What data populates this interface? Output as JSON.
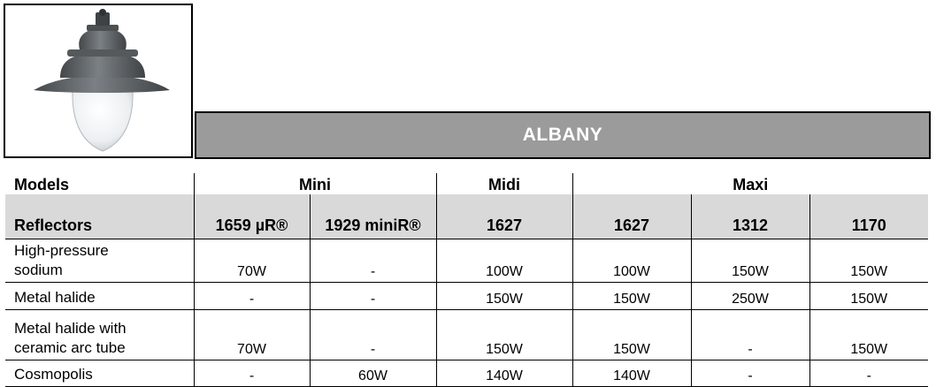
{
  "product": {
    "name": "ALBANY",
    "image": "street-lantern-luminaire"
  },
  "table": {
    "models_label": "Models",
    "groups": [
      "Mini",
      "Midi",
      "Maxi"
    ],
    "reflectors_label": "Reflectors",
    "reflectors": [
      "1659  µR®",
      "1929 miniR®",
      "1627",
      "1627",
      "1312",
      "1170"
    ],
    "rows": [
      {
        "label_lines": [
          "High-pressure",
          "sodium"
        ],
        "values": [
          "70W",
          "-",
          "100W",
          "100W",
          "150W",
          "150W"
        ]
      },
      {
        "label_lines": [
          "Metal halide"
        ],
        "values": [
          "-",
          "-",
          "150W",
          "150W",
          "250W",
          "150W"
        ]
      },
      {
        "label_lines": [
          "Metal halide with",
          "ceramic arc tube"
        ],
        "values": [
          "70W",
          "-",
          "150W",
          "150W",
          "-",
          "150W"
        ]
      },
      {
        "label_lines": [
          "Cosmopolis"
        ],
        "values": [
          "-",
          "60W",
          "140W",
          "140W",
          "-",
          "-"
        ]
      }
    ]
  },
  "colors": {
    "title_bar": "#9b9b9b",
    "header_row": "#d9d9d9",
    "lamp_body": "#5f6366"
  }
}
